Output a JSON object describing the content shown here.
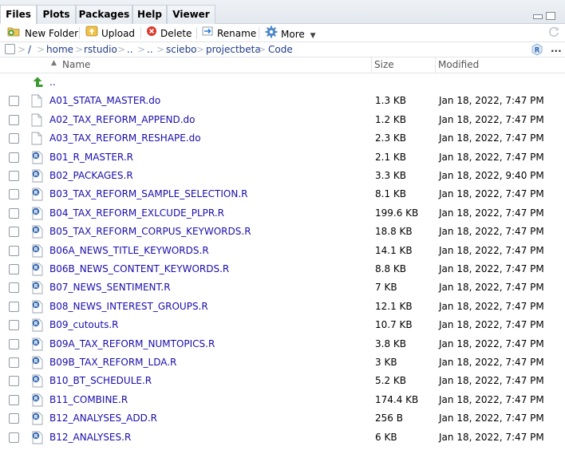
{
  "tabs": [
    "Files",
    "Plots",
    "Packages",
    "Help",
    "Viewer"
  ],
  "toolbar": {
    "new_folder": "New Folder",
    "upload": "Upload",
    "delete": "Delete",
    "rename": "Rename",
    "more": "More"
  },
  "breadcrumb": [
    "home",
    "rstudio",
    "..",
    "..",
    "sciebo",
    "projectbeta",
    "Code"
  ],
  "breadcrumb_root": "/",
  "more_menu_glyph": "...",
  "columns": {
    "name": "Name",
    "size": "Size",
    "modified": "Modified"
  },
  "parent_dir": "..",
  "files": [
    {
      "name": "A01_STATA_MASTER.do",
      "size": "1.3 KB",
      "modified": "Jan 18, 2022, 7:47 PM",
      "type": "doc"
    },
    {
      "name": "A02_TAX_REFORM_APPEND.do",
      "size": "1.2 KB",
      "modified": "Jan 18, 2022, 7:47 PM",
      "type": "doc"
    },
    {
      "name": "A03_TAX_REFORM_RESHAPE.do",
      "size": "2.3 KB",
      "modified": "Jan 18, 2022, 7:47 PM",
      "type": "doc"
    },
    {
      "name": "B01_R_MASTER.R",
      "size": "2.1 KB",
      "modified": "Jan 18, 2022, 7:47 PM",
      "type": "r"
    },
    {
      "name": "B02_PACKAGES.R",
      "size": "3.3 KB",
      "modified": "Jan 18, 2022, 9:40 PM",
      "type": "r"
    },
    {
      "name": "B03_TAX_REFORM_SAMPLE_SELECTION.R",
      "size": "8.1 KB",
      "modified": "Jan 18, 2022, 7:47 PM",
      "type": "r"
    },
    {
      "name": "B04_TAX_REFORM_EXLCUDE_PLPR.R",
      "size": "199.6 KB",
      "modified": "Jan 18, 2022, 7:47 PM",
      "type": "r"
    },
    {
      "name": "B05_TAX_REFORM_CORPUS_KEYWORDS.R",
      "size": "18.8 KB",
      "modified": "Jan 18, 2022, 7:47 PM",
      "type": "r"
    },
    {
      "name": "B06A_NEWS_TITLE_KEYWORDS.R",
      "size": "14.1 KB",
      "modified": "Jan 18, 2022, 7:47 PM",
      "type": "r"
    },
    {
      "name": "B06B_NEWS_CONTENT_KEYWORDS.R",
      "size": "8.8 KB",
      "modified": "Jan 18, 2022, 7:47 PM",
      "type": "r"
    },
    {
      "name": "B07_NEWS_SENTIMENT.R",
      "size": "7 KB",
      "modified": "Jan 18, 2022, 7:47 PM",
      "type": "r"
    },
    {
      "name": "B08_NEWS_INTEREST_GROUPS.R",
      "size": "12.1 KB",
      "modified": "Jan 18, 2022, 7:47 PM",
      "type": "r"
    },
    {
      "name": "B09_cutouts.R",
      "size": "10.7 KB",
      "modified": "Jan 18, 2022, 7:47 PM",
      "type": "r"
    },
    {
      "name": "B09A_TAX_REFORM_NUMTOPICS.R",
      "size": "3.8 KB",
      "modified": "Jan 18, 2022, 7:47 PM",
      "type": "r"
    },
    {
      "name": "B09B_TAX_REFORM_LDA.R",
      "size": "3 KB",
      "modified": "Jan 18, 2022, 7:47 PM",
      "type": "r"
    },
    {
      "name": "B10_BT_SCHEDULE.R",
      "size": "5.2 KB",
      "modified": "Jan 18, 2022, 7:47 PM",
      "type": "r"
    },
    {
      "name": "B11_COMBINE.R",
      "size": "174.4 KB",
      "modified": "Jan 18, 2022, 7:47 PM",
      "type": "r"
    },
    {
      "name": "B12_ANALYSES_ADD.R",
      "size": "256 B",
      "modified": "Jan 18, 2022, 7:47 PM",
      "type": "r"
    },
    {
      "name": "B12_ANALYSES.R",
      "size": "6 KB",
      "modified": "Jan 18, 2022, 7:47 PM",
      "type": "r"
    }
  ],
  "colors": {
    "link": "#1a0dab",
    "path": "#1f3c88",
    "r_icon": "#3a6db5",
    "up_arrow": "#3c9a2e"
  }
}
